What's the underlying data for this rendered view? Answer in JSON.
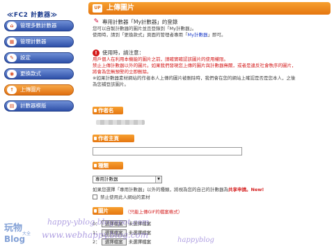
{
  "sidebar": {
    "brand": "≪FC2 計數器≫",
    "items": [
      {
        "label": "管理多數計數器",
        "icon": "home-icon"
      },
      {
        "label": "管理計數器",
        "icon": "counter-icon"
      },
      {
        "label": "設定",
        "icon": "wrench-icon"
      },
      {
        "label": "更換款式",
        "icon": "style-icon"
      },
      {
        "label": "上傳圖片",
        "icon": "upload-icon",
        "active": true
      },
      {
        "label": "計數器模版",
        "icon": "template-icon"
      }
    ]
  },
  "header": {
    "title": "上傳圖片",
    "icon_text": "UP"
  },
  "notice_special": {
    "title": "專用計數器「My計數器」的登錄",
    "lines": [
      "您可以自製計數器的圖片並且登錄到「My計數器」。",
      "使用時，請到「更換款式」頁面的管理者專用「My計數器」即可。"
    ],
    "link_text": "My計數器"
  },
  "notice_usage": {
    "title": "使用時，請注意：",
    "red_lines": [
      "用戶個人在利用本機能的圖片之前，請確實確認該圖片的使用權限。",
      "禁止上傳計數器以外的圖片。如果我們發現您上傳的圖片與計數器無關，或者是違反社會秩序的圖片，",
      "將會為您無預警的立即刪除。"
    ],
    "black_lines": [
      "※如果計數器素材網站的作者本人上傳的圖片被刪除時，我們會在您的網站上確認是否是您本人，之後",
      "為您補登該圖片。"
    ]
  },
  "form": {
    "author_label": "作者名",
    "homepage_label": "作者主頁",
    "type_label": "種類",
    "type_value": "專用計數器",
    "type_hint_prefix": "如果您選擇「專用計數器」以外的種類，將視為您的自己的計數器為",
    "type_hint_highlight": "共享申請。New!",
    "checkbox_label": "禁止使用此人網站的素材",
    "image_label": "圖片",
    "image_hint": "（只能上傳GIF的檔案格式）",
    "file_rows": [
      {
        "index": "0：",
        "button": "選擇檔案",
        "status": "未選擇檔案"
      },
      {
        "index": "1：",
        "button": "選擇檔案",
        "status": "未選擇檔案"
      },
      {
        "index": "2：",
        "button": "選擇檔案",
        "status": "未選擇檔案"
      }
    ]
  },
  "watermark": {
    "logo_chars": "玩物",
    "logo_sub": "大全",
    "logo_word": "Blog",
    "url1": "happy-yblog.blogspot.com",
    "url2": "www.webhappy.blog.com",
    "url3": "happyblog"
  },
  "colors": {
    "accent": "#e57610",
    "nav_blue": "#2e50a8",
    "warning_red": "#d41a1a"
  }
}
